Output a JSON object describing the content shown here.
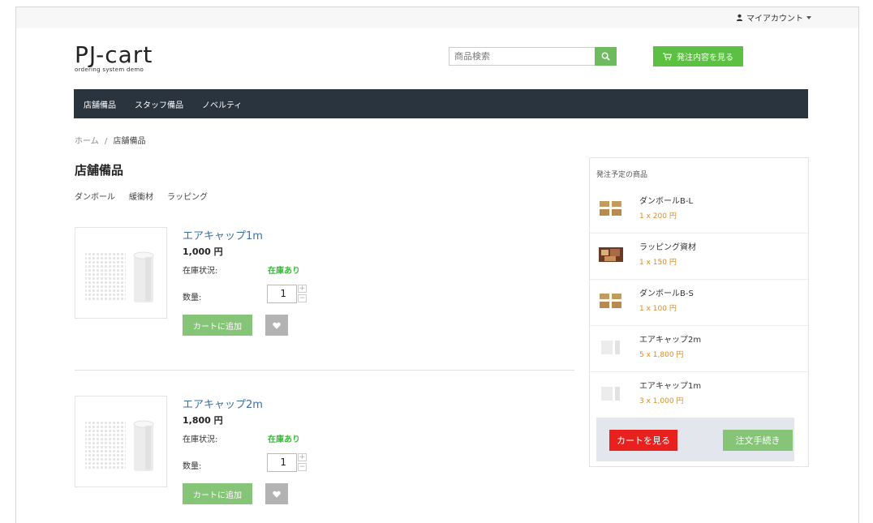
{
  "header": {
    "account_label": "マイアカウント",
    "logo_title": "PJ-cart",
    "logo_subtitle": "ordering system demo",
    "search_placeholder": "商品検索",
    "order_button_label": "発注内容を見る"
  },
  "nav": {
    "items": [
      {
        "label": "店舗備品"
      },
      {
        "label": "スタッフ備品"
      },
      {
        "label": "ノベルティ"
      }
    ]
  },
  "breadcrumb": {
    "home": "ホーム",
    "separator": "/",
    "current": "店舗備品"
  },
  "page": {
    "title": "店舗備品",
    "subcategories": [
      "ダンボール",
      "緩衝材",
      "ラッピング"
    ]
  },
  "products": [
    {
      "name": "エアキャップ1m",
      "price": "1,000 円",
      "stock_label": "在庫状況:",
      "stock_value": "在庫あり",
      "qty_label": "数量:",
      "qty": "1",
      "add_label": "カートに追加"
    },
    {
      "name": "エアキャップ2m",
      "price": "1,800 円",
      "stock_label": "在庫状況:",
      "stock_value": "在庫あり",
      "qty_label": "数量:",
      "qty": "1",
      "add_label": "カートに追加"
    }
  ],
  "cart": {
    "title": "発注予定の商品",
    "items": [
      {
        "name": "ダンボールB-L",
        "qty": "1 x 200 円",
        "thumb": "cardboard-boxes"
      },
      {
        "name": "ラッピング資材",
        "qty": "1 x 150 円",
        "thumb": "wrapping-materials"
      },
      {
        "name": "ダンボールB-S",
        "qty": "1 x 100 円",
        "thumb": "cardboard-boxes"
      },
      {
        "name": "エアキャップ2m",
        "qty": "5 x 1,800 円",
        "thumb": "air-cap-roll"
      },
      {
        "name": "エアキャップ1m",
        "qty": "3 x 1,000 円",
        "thumb": "air-cap-roll"
      }
    ],
    "view_cart_label": "カートを見る",
    "checkout_label": "注文手続き"
  },
  "colors": {
    "nav_bg": "#2a343e",
    "green_button": "#5cc042",
    "light_green_button": "#86c478",
    "red_button": "#e8201e",
    "stock_green": "#3cb83c",
    "price_orange": "#e08a1e",
    "link_blue": "#3a6fa8"
  }
}
